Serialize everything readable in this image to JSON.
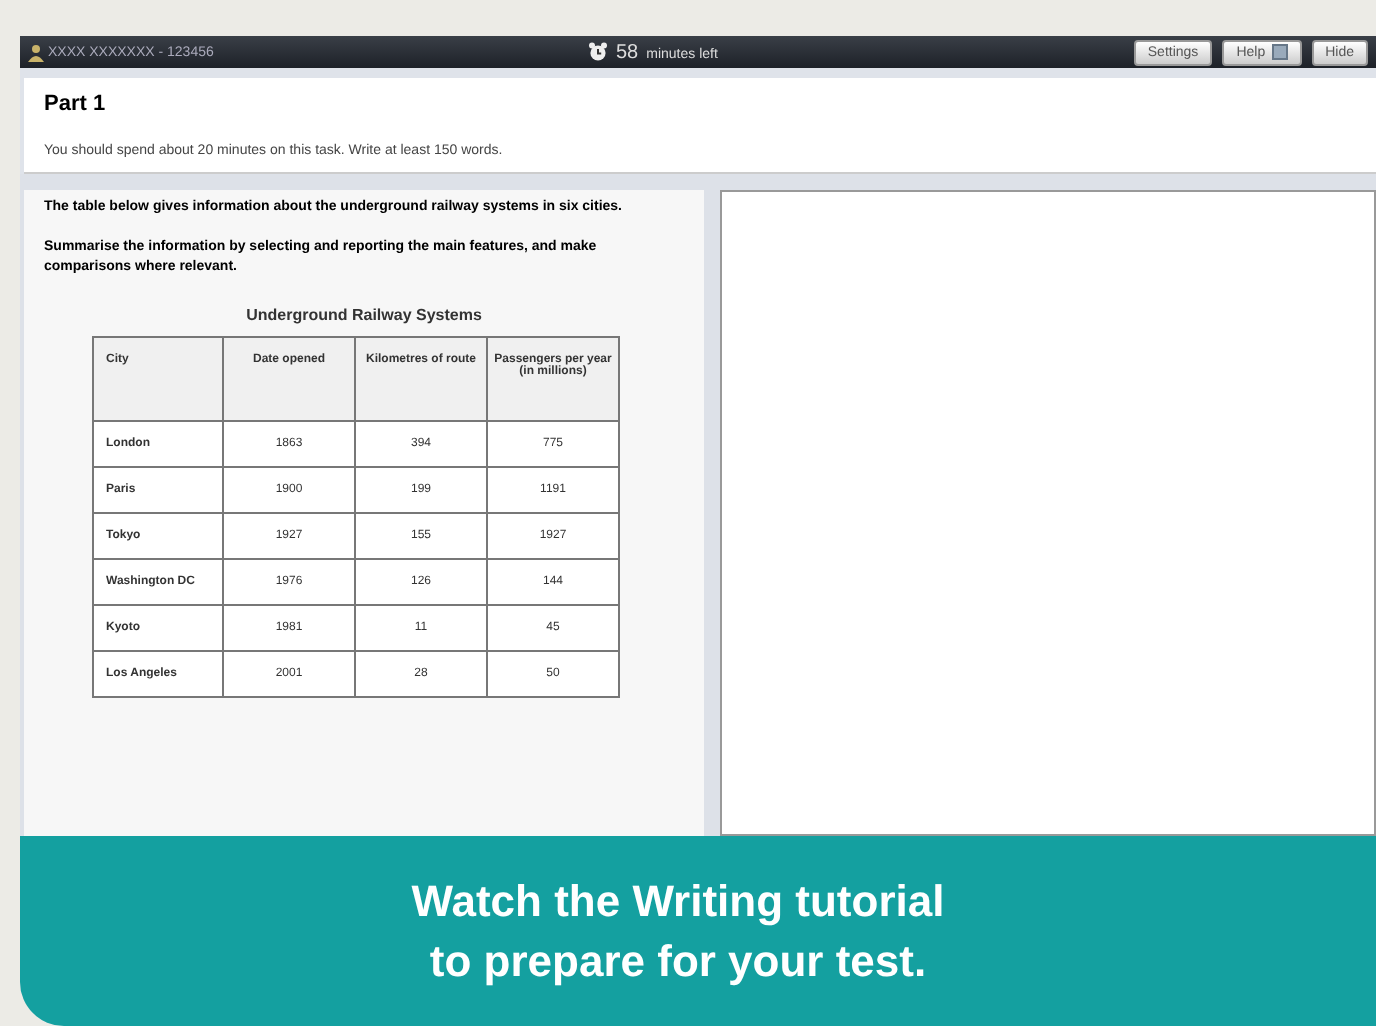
{
  "top_bar": {
    "candidate": "XXXX XXXXXXX - 123456",
    "time_value": "58",
    "time_unit": "minutes left",
    "buttons": [
      {
        "label": "Settings",
        "kind": "plain"
      },
      {
        "label": "Help",
        "kind": "help"
      },
      {
        "label": "Hide",
        "kind": "plain"
      }
    ]
  },
  "header": {
    "title": "Part 1",
    "instruction": "You should spend about 20 minutes on this task. Write at least 150 words."
  },
  "task": {
    "paragraphs": [
      "The table below gives information about the underground railway systems in six cities.",
      "Summarise the information by selecting and reporting the main features, and make comparisons where relevant."
    ],
    "table": {
      "title": "Underground Railway Systems",
      "columns": [
        "City",
        "Date opened",
        "Kilometres of route",
        "Passengers per year (in millions)"
      ],
      "rows": [
        [
          "London",
          "1863",
          "394",
          "775"
        ],
        [
          "Paris",
          "1900",
          "199",
          "1191"
        ],
        [
          "Tokyo",
          "1927",
          "155",
          "1927"
        ],
        [
          "Washington DC",
          "1976",
          "126",
          "144"
        ],
        [
          "Kyoto",
          "1981",
          "11",
          "45"
        ],
        [
          "Los Angeles",
          "2001",
          "28",
          "50"
        ]
      ]
    }
  },
  "banner": {
    "lines": [
      "Watch the Writing tutorial",
      "to prepare for your test."
    ]
  }
}
